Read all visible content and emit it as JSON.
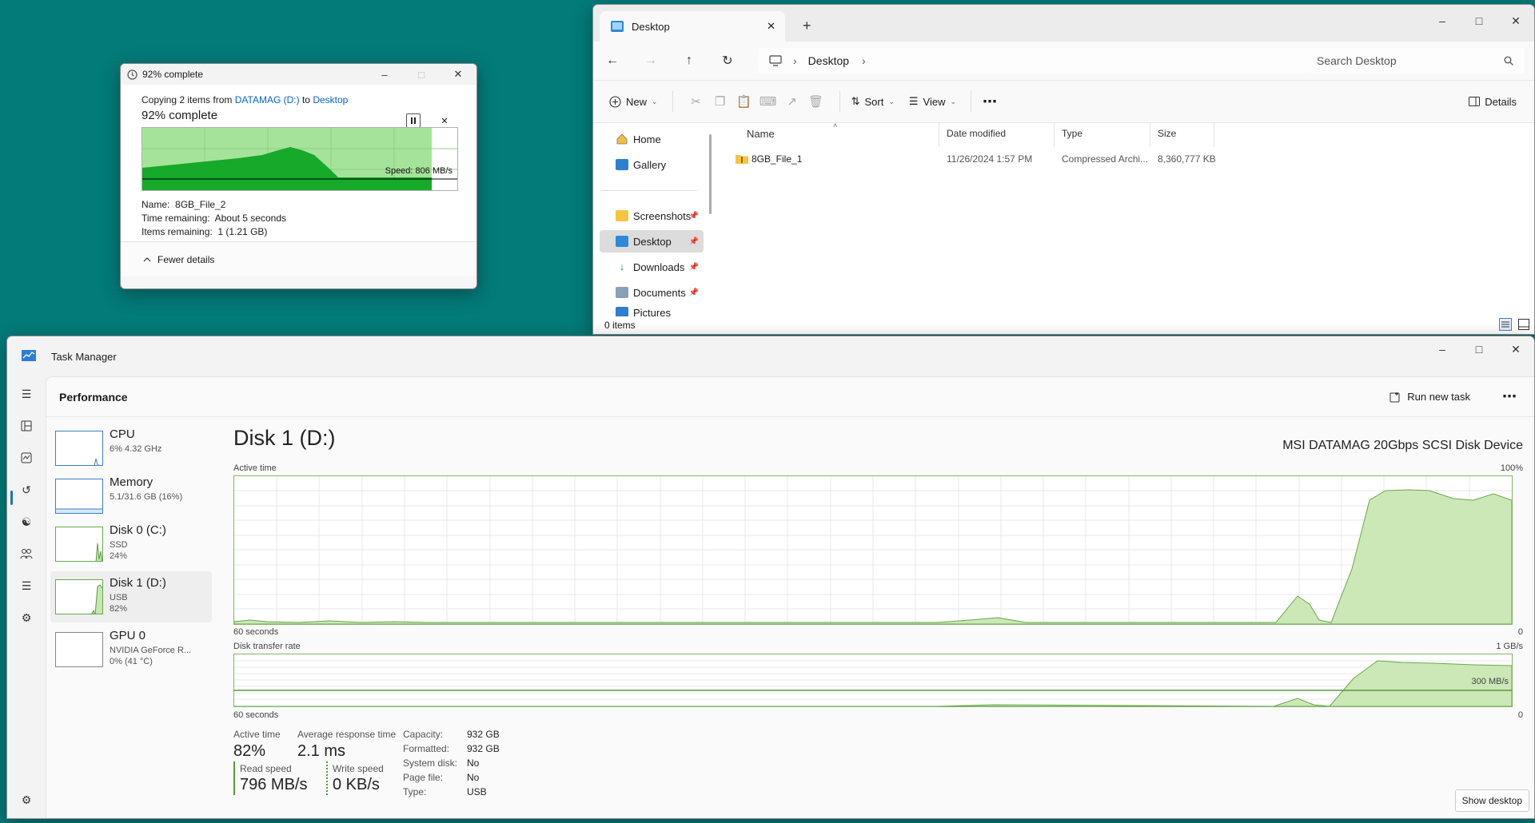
{
  "copy_dialog": {
    "title": "92% complete",
    "copy_prefix": "Copying 2 items from",
    "source": "DATAMAG (D:)",
    "to": "to",
    "destination": "Desktop",
    "progress_text": "92% complete",
    "progress": 0.92,
    "speed": "Speed: 806 MB/s",
    "name_label": "Name:",
    "name_value": "8GB_File_2",
    "time_label": "Time remaining:",
    "time_value": "About 5 seconds",
    "items_label": "Items remaining:",
    "items_value": "1 (1.21 GB)",
    "details_toggle": "Fewer details"
  },
  "explorer": {
    "tab_title": "Desktop",
    "breadcrumb": "Desktop",
    "search_placeholder": "Search Desktop",
    "toolbar": {
      "new": "New",
      "sort": "Sort",
      "view": "View",
      "details": "Details"
    },
    "nav": [
      {
        "label": "Home"
      },
      {
        "label": "Gallery"
      },
      {
        "label": "Screenshots"
      },
      {
        "label": "Desktop"
      },
      {
        "label": "Downloads"
      },
      {
        "label": "Documents"
      },
      {
        "label": "Pictures"
      }
    ],
    "columns": {
      "name": "Name",
      "date": "Date modified",
      "type": "Type",
      "size": "Size"
    },
    "files": [
      {
        "name": "8GB_File_1",
        "date": "11/26/2024 1:57 PM",
        "type": "Compressed Archi...",
        "size": "8,360,777 KB"
      }
    ],
    "status": "0 items"
  },
  "task_manager": {
    "title": "Task Manager",
    "page": "Performance",
    "run_new_task": "Run new task",
    "devices": [
      {
        "name": "CPU",
        "line1": "6% 4.32 GHz",
        "line2": ""
      },
      {
        "name": "Memory",
        "line1": "5.1/31.6 GB (16%)",
        "line2": ""
      },
      {
        "name": "Disk 0 (C:)",
        "line1": "SSD",
        "line2": "24%"
      },
      {
        "name": "Disk 1 (D:)",
        "line1": "USB",
        "line2": "82%"
      },
      {
        "name": "GPU 0",
        "line1": "NVIDIA GeForce R...",
        "line2": "0% (41 °C)"
      }
    ],
    "disk_title": "Disk 1 (D:)",
    "disk_model": "MSI DATAMAG 20Gbps SCSI Disk Device",
    "active_time_label": "Active time",
    "active_max": "100%",
    "time_span": "60 seconds",
    "zero": "0",
    "transfer_label": "Disk transfer rate",
    "transfer_max": "1 GB/s",
    "transfer_mid": "300 MB/s",
    "stats": {
      "active_time_label": "Active time",
      "active_time": "82%",
      "response_label": "Average response time",
      "response": "2.1 ms",
      "read_label": "Read speed",
      "read": "796 MB/s",
      "write_label": "Write speed",
      "write": "0 KB/s"
    },
    "props": [
      {
        "k": "Capacity:",
        "v": "932 GB"
      },
      {
        "k": "Formatted:",
        "v": "932 GB"
      },
      {
        "k": "System disk:",
        "v": "No"
      },
      {
        "k": "Page file:",
        "v": "No"
      },
      {
        "k": "Type:",
        "v": "USB"
      }
    ],
    "show_desktop": "Show desktop"
  }
}
